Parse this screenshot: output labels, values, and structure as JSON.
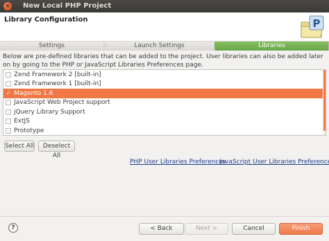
{
  "window": {
    "title": "New Local PHP Project",
    "close_glyph": "×"
  },
  "banner": {
    "title": "Library Configuration",
    "icon": "php-project-folder-icon"
  },
  "tabs": [
    {
      "label": "Settings",
      "active": false
    },
    {
      "label": "Launch Settings",
      "active": false
    },
    {
      "label": "Libraries",
      "active": true
    }
  ],
  "description": "Below are pre-defined libraries that can be added to the project. User libraries can also be added later on by going to the PHP or JavaScript Libraries Preferences page.",
  "libraries": [
    {
      "label": "Zend Framework 2 [built-in]",
      "checked": false,
      "selected": false
    },
    {
      "label": "Zend Framework 1 [built-in]",
      "checked": false,
      "selected": false
    },
    {
      "label": "Magento 1.6",
      "checked": true,
      "selected": true
    },
    {
      "label": "JavaScript Web Project support",
      "checked": false,
      "selected": false
    },
    {
      "label": "jQuery Library Support",
      "checked": false,
      "selected": false
    },
    {
      "label": "ExtJS",
      "checked": false,
      "selected": false
    },
    {
      "label": "Prototype",
      "checked": false,
      "selected": false
    }
  ],
  "buttons": {
    "select_all": "Select All",
    "deselect_all": "Deselect All",
    "back": "< Back",
    "next": "Next >",
    "cancel": "Cancel",
    "finish": "Finish",
    "help": "?"
  },
  "links": {
    "php_prefs": "PHP User Libraries Preferences",
    "js_prefs": "JavaScript User Libraries Preferences"
  },
  "colors": {
    "accent": "#f07746",
    "tab_active": "#78b454",
    "link": "#1a3c8a"
  }
}
